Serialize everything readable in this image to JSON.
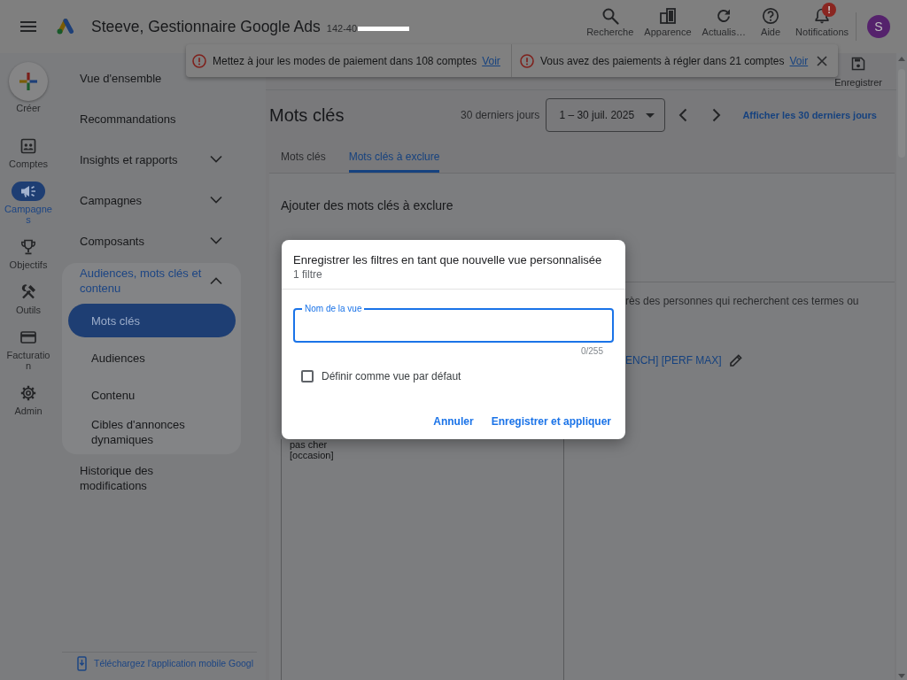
{
  "header": {
    "title": "Steeve, Gestionnaire Google Ads",
    "account_id": "142-40",
    "actions": [
      {
        "kind": "search",
        "label": "Recherche"
      },
      {
        "kind": "appearance",
        "label": "Apparence"
      },
      {
        "kind": "refresh",
        "label": "Actualis…"
      },
      {
        "kind": "help",
        "label": "Aide"
      },
      {
        "kind": "notifications",
        "label": "Notifications",
        "badge": "!"
      }
    ],
    "avatar": "S"
  },
  "alerts": [
    {
      "text": "Mettez à jour les modes de paiement dans 108 comptes",
      "link": "Voir"
    },
    {
      "text": "Vous avez des paiements à régler dans 21 comptes",
      "link": "Voir"
    }
  ],
  "rail": {
    "create": "Créer",
    "items": [
      {
        "kind": "accounts",
        "label": "Comptes",
        "selected": false
      },
      {
        "kind": "campaigns",
        "label": "Campagnes",
        "selected": true
      },
      {
        "kind": "goals",
        "label": "Objectifs",
        "selected": false
      },
      {
        "kind": "tools",
        "label": "Outils",
        "selected": false
      },
      {
        "kind": "billing",
        "label": "Facturation",
        "selected": false
      },
      {
        "kind": "admin",
        "label": "Admin",
        "selected": false
      }
    ]
  },
  "nav": {
    "items": [
      {
        "label": "Vue d'ensemble",
        "selected": false
      },
      {
        "label": "Recommandations",
        "selected": false
      },
      {
        "label": "Insights et rapports",
        "selected": false,
        "expanded": false
      },
      {
        "label": "Campagnes",
        "selected": false,
        "expanded": false
      },
      {
        "label": "Composants",
        "selected": false,
        "expanded": false
      },
      {
        "label": "Audiences, mots clés et contenu",
        "selected": false,
        "expanded": true,
        "children": [
          {
            "label": "Mots clés",
            "selected": true
          },
          {
            "label": "Audiences",
            "selected": false
          },
          {
            "label": "Contenu",
            "selected": false
          },
          {
            "label": "Cibles d'annonces dynamiques",
            "selected": false
          }
        ]
      },
      {
        "label": "Historique des modifications",
        "selected": false
      }
    ],
    "app_link": "Téléchargez l'application mobile Googl"
  },
  "toolbar": {
    "save": "Enregistrer"
  },
  "page": {
    "title": "Mots clés",
    "range_label": "30 derniers jours",
    "date_range": "1 – 30 juil. 2025",
    "range_link": "Afficher les 30 derniers jours"
  },
  "tabs": [
    {
      "label": "Mots clés",
      "selected": false
    },
    {
      "label": "Mots clés à exclure",
      "selected": true
    }
  ],
  "exclude": {
    "heading": "Ajouter des mots clés à exclure",
    "keywords": [
      "pas cher",
      "[occasion]"
    ],
    "note": "rès des personnes qui recherchent ces termes ou",
    "list_link": "ENCH] [PERF MAX]"
  },
  "dialog": {
    "title": "Enregistrer les filtres en tant que nouvelle vue personnalisée",
    "subtitle": "1 filtre",
    "field": {
      "label": "Nom de la vue",
      "focused": true,
      "counter": "0/255"
    },
    "checkbox": {
      "label": "Définir comme vue par défaut",
      "checked": false
    },
    "buttons": [
      "Annuler",
      "Enregistrer et appliquer"
    ]
  }
}
